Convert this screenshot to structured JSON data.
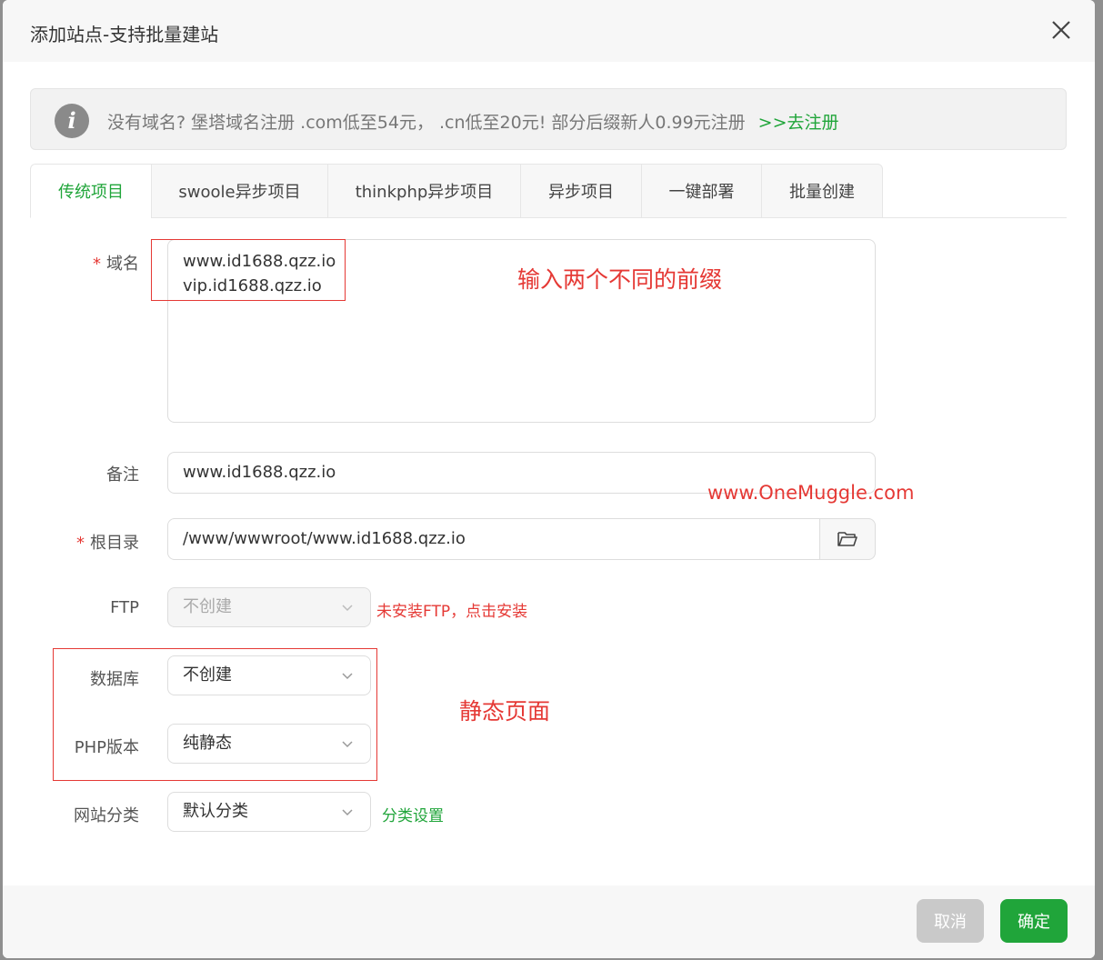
{
  "dialog": {
    "title": "添加站点-支持批量建站"
  },
  "notice": {
    "text": "没有域名? 堡塔域名注册 .com低至54元， .cn低至20元! 部分后缀新人0.99元注册",
    "link": ">>去注册"
  },
  "tabs": [
    {
      "label": "传统项目",
      "active": true
    },
    {
      "label": "swoole异步项目",
      "active": false
    },
    {
      "label": "thinkphp异步项目",
      "active": false
    },
    {
      "label": "异步项目",
      "active": false
    },
    {
      "label": "一键部署",
      "active": false
    },
    {
      "label": "批量创建",
      "active": false
    }
  ],
  "form": {
    "domain": {
      "required_mark": "*",
      "label": "域名",
      "value": "www.id1688.qzz.io\nvip.id1688.qzz.io"
    },
    "remark": {
      "label": "备注",
      "value": "www.id1688.qzz.io"
    },
    "root": {
      "required_mark": "*",
      "label": "根目录",
      "value": "/www/wwwroot/www.id1688.qzz.io"
    },
    "ftp": {
      "label": "FTP",
      "value": "不创建",
      "hint": "未安装FTP，点击安装"
    },
    "database": {
      "label": "数据库",
      "value": "不创建"
    },
    "php": {
      "label": "PHP版本",
      "value": "纯静态"
    },
    "category": {
      "label": "网站分类",
      "value": "默认分类",
      "hint": "分类设置"
    }
  },
  "annotations": {
    "domain_note": "输入两个不同的前缀",
    "static_note": "静态页面",
    "watermark": "www.OneMuggle.com"
  },
  "footer": {
    "cancel": "取消",
    "ok": "确定"
  },
  "colors": {
    "accent": "#20a53a",
    "annotation": "#e53935"
  }
}
